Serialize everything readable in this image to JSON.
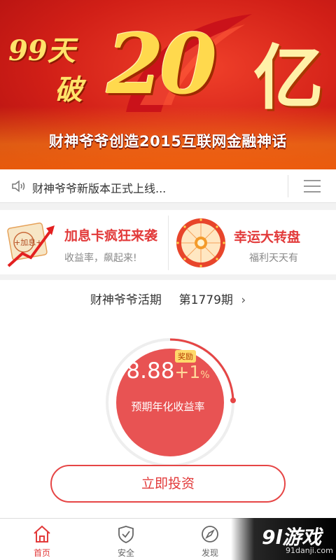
{
  "banner": {
    "left_line1": "99天",
    "left_line2": "破",
    "big_number": "20",
    "big_unit": "亿",
    "caption": "财神爷爷创造2015互联网金融神话"
  },
  "notice": {
    "text": "财神爷爷新版本正式上线...",
    "icon": "speaker-icon",
    "menu_icon": "hamburger-menu-icon"
  },
  "promo": [
    {
      "title": "加息卡疯狂来袭",
      "subtitle": "收益率，飙起来!",
      "icon": "rate-card-icon"
    },
    {
      "title": "幸运大转盘",
      "subtitle": "福利天天有",
      "icon": "lucky-wheel-icon"
    }
  ],
  "product": {
    "name": "财神爷爷活期",
    "period": "第1779期",
    "rate_main": "8.88",
    "rate_bonus": "+1",
    "rate_pct": "%",
    "bonus_badge": "奖励",
    "rate_label": "预期年化收益率",
    "invest_button": "立即投资"
  },
  "tabs": [
    {
      "label": "首页",
      "icon": "home-icon",
      "active": true
    },
    {
      "label": "安全",
      "icon": "shield-check-icon",
      "active": false
    },
    {
      "label": "发现",
      "icon": "compass-icon",
      "active": false
    }
  ],
  "watermark": {
    "logo": "9l游戏",
    "url": "91danji.com"
  },
  "colors": {
    "brand_red": "#e23a3a",
    "circle_red": "#e85353",
    "banner_gold": "#ffd94d"
  }
}
